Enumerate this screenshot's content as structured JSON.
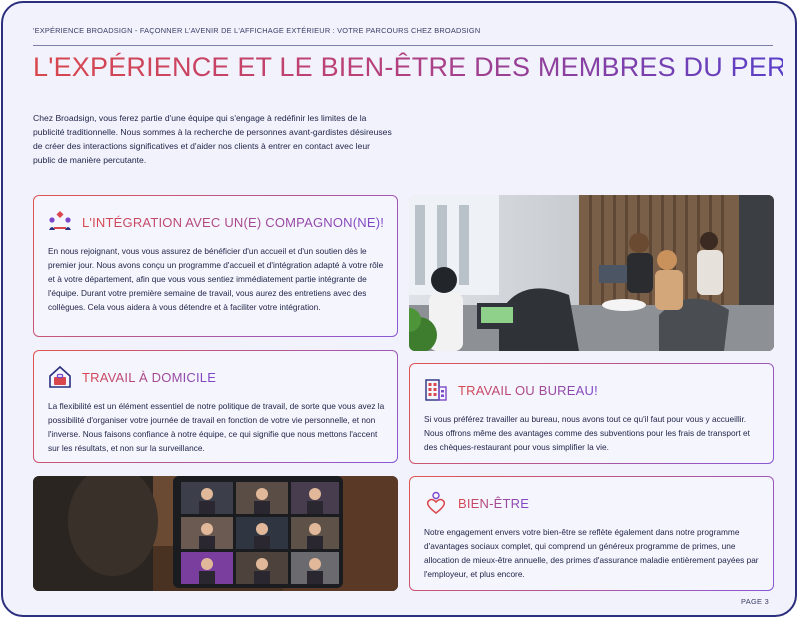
{
  "header": {
    "breadcrumb": "'EXPÉRIENCE BROADSIGN - FAÇONNER L'AVENIR DE L'AFFICHAGE EXTÉRIEUR : VOTRE PARCOURS CHEZ BROADSIGN",
    "title": "L'EXPÉRIENCE ET LE BIEN-ÊTRE DES MEMBRES DU PERSONNEL"
  },
  "intro": "Chez Broadsign, vous ferez partie d'une équipe qui s'engage à redéfinir les limites de la publicité traditionnelle. Nous sommes à la recherche de personnes avant-gardistes désireuses de créer des interactions significatives et d'aider nos clients à entrer en contact avec leur public de manière percutante.",
  "cards": {
    "integration": {
      "icon": "team-icon",
      "title": "L'INTÉGRATION AVEC UN(E) COMPAGNON(NE)!",
      "body": "En nous rejoignant, vous vous assurez de bénéficier d'un accueil et d'un soutien dès le premier jour. Nous avons conçu un programme d'accueil et d'intégration adapté à votre rôle et à votre département, afin que vous vous sentiez immédiatement partie intégrante de l'équipe. Durant votre première semaine de travail, vous aurez des entretiens avec des collègues. Cela vous aidera à vous détendre et à faciliter votre intégration."
    },
    "domicile": {
      "icon": "home-briefcase-icon",
      "title": "TRAVAIL À DOMICILE",
      "body": "La flexibilité est un élément essentiel de notre politique de travail, de sorte que vous avez la possibilité d'organiser votre journée de travail en fonction de votre vie personnelle, et non l'inverse. Nous faisons confiance à notre équipe, ce qui signifie que nous mettons l'accent sur les résultats, et non sur la surveillance."
    },
    "bureau": {
      "icon": "office-building-icon",
      "title": "TRAVAIL OU BUREAU!",
      "body": "Si vous préférez travailler au bureau, nous avons tout ce qu'il faut pour vous y accueillir. Nous offrons même des avantages comme des subventions pour les frais de transport et des chèques-restaurant pour vous simplifier la vie."
    },
    "bienetre": {
      "icon": "heart-person-icon",
      "title": "BIEN-ÊTRE",
      "body": "Notre engagement envers votre bien-être se reflète également dans notre programme d'avantages sociaux complet, qui comprend un généreux programme de primes, une allocation de mieux-être annuelle, des primes d'assurance maladie entièrement payées par l'employeur, et plus encore."
    }
  },
  "footer": {
    "page": "PAGE 3"
  }
}
